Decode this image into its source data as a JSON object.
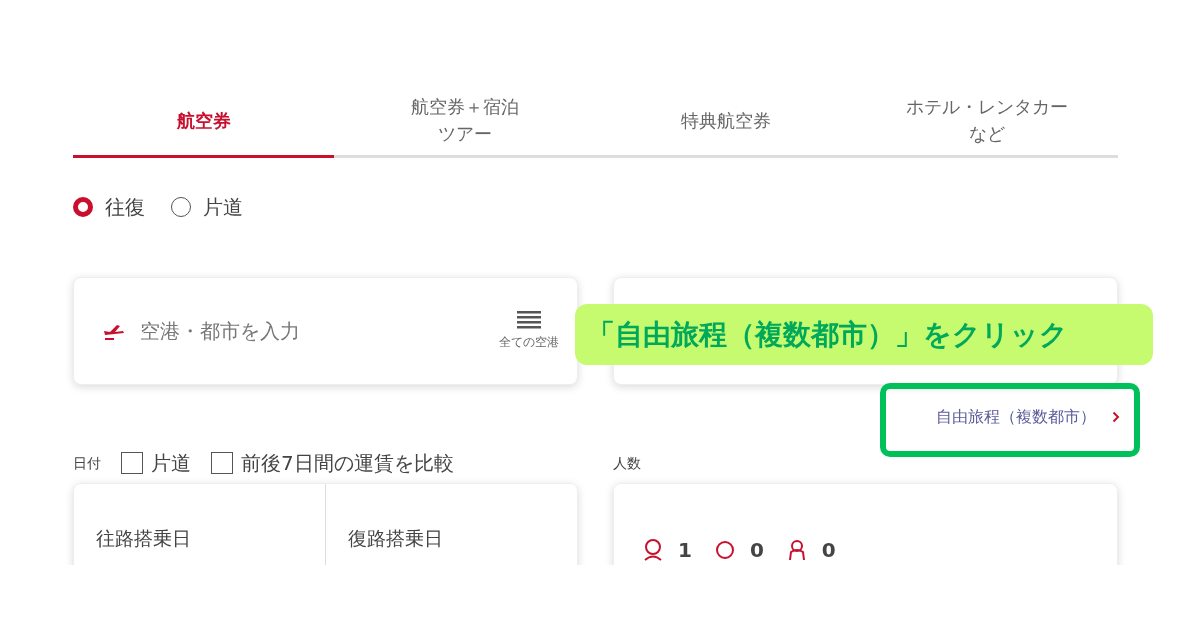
{
  "tabs": [
    {
      "lines": [
        "航空券"
      ],
      "selected": true
    },
    {
      "lines": [
        "航空券＋宿泊",
        "ツアー"
      ],
      "selected": false
    },
    {
      "lines": [
        "特典航空券"
      ],
      "selected": false
    },
    {
      "lines": [
        "ホテル・レンタカー",
        "など"
      ],
      "selected": false
    }
  ],
  "trip_type": [
    {
      "label": "往復",
      "selected": true
    },
    {
      "label": "片道",
      "selected": false
    }
  ],
  "origin": {
    "placeholder": "空港・都市を入力",
    "all_airports": "全ての空港"
  },
  "callout": "「自由旅程（複数都市）」をクリック",
  "multi_city_link": "自由旅程（複数都市）",
  "date_label": "日付",
  "date_options": [
    {
      "label": "片道",
      "checked": false
    },
    {
      "label": "前後7日間の運賃を比較",
      "checked": false
    }
  ],
  "dates": [
    "往路搭乗日",
    "復路搭乗日"
  ],
  "passengers_label": "人数",
  "passengers": [
    {
      "kind": "adult",
      "count": "1"
    },
    {
      "kind": "child",
      "count": "0"
    },
    {
      "kind": "infant",
      "count": "0"
    }
  ]
}
